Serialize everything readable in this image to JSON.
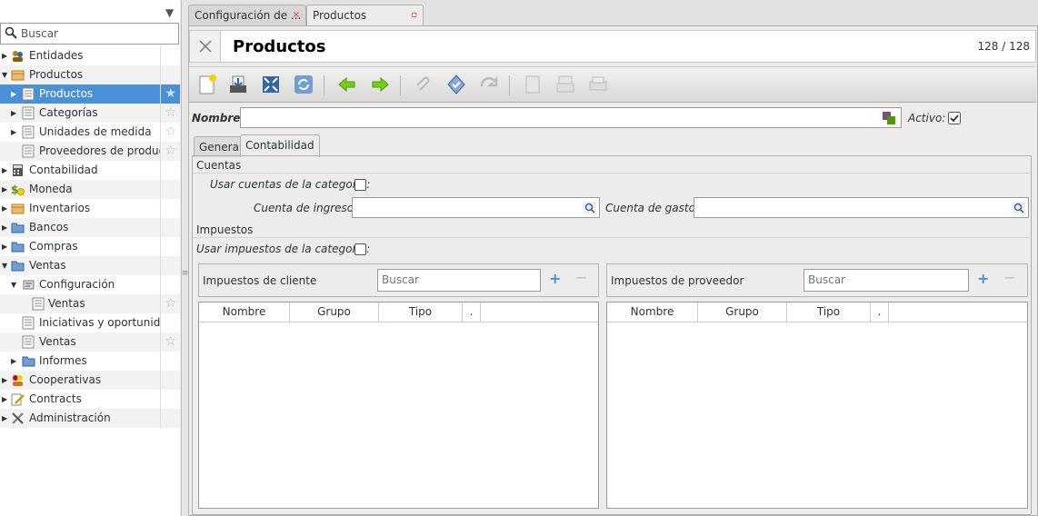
{
  "sidebar": {
    "search_placeholder": "Buscar",
    "items": [
      {
        "label": "Entidades",
        "icon": "people-icon"
      },
      {
        "label": "Productos",
        "icon": "box-icon"
      },
      {
        "label": "Productos",
        "icon": "list-icon"
      },
      {
        "label": "Categorías",
        "icon": "list-icon"
      },
      {
        "label": "Unidades de medida",
        "icon": "list-icon"
      },
      {
        "label": "Proveedores de producto",
        "icon": "list-icon"
      },
      {
        "label": "Contabilidad",
        "icon": "calculator-icon"
      },
      {
        "label": "Moneda",
        "icon": "money-icon"
      },
      {
        "label": "Inventarios",
        "icon": "box-icon"
      },
      {
        "label": "Bancos",
        "icon": "folder-icon"
      },
      {
        "label": "Compras",
        "icon": "folder-icon"
      },
      {
        "label": "Ventas",
        "icon": "folder-icon"
      },
      {
        "label": "Configuración",
        "icon": "settings-icon"
      },
      {
        "label": "Ventas",
        "icon": "list-icon"
      },
      {
        "label": "Iniciativas y oportunidad",
        "icon": "list-icon"
      },
      {
        "label": "Ventas",
        "icon": "list-icon"
      },
      {
        "label": "Informes",
        "icon": "folder-icon"
      },
      {
        "label": "Cooperativas",
        "icon": "people-icon"
      },
      {
        "label": "Contracts",
        "icon": "edit-icon"
      },
      {
        "label": "Administración",
        "icon": "tools-icon"
      }
    ]
  },
  "tabs": [
    {
      "label": "Configuración de ..."
    },
    {
      "label": "Productos"
    }
  ],
  "header": {
    "title": "Productos",
    "record_counter": "128 / 128"
  },
  "form": {
    "name_label": "Nombre:",
    "active_label": "Activo:",
    "active_checked": true,
    "subtabs": [
      {
        "label": "General"
      },
      {
        "label": "Contabilidad"
      }
    ],
    "cuentas_heading": "Cuentas",
    "use_category_accounts_label": "Usar cuentas de la categoría:",
    "income_account_label": "Cuenta de ingresos:",
    "expense_account_label": "Cuenta de gastos:",
    "impuestos_heading": "Impuestos",
    "use_category_taxes_label": "Usar impuestos de la categoría:",
    "customer_taxes": {
      "title": "Impuestos de cliente",
      "search_placeholder": "Buscar",
      "columns": [
        "Nombre",
        "Grupo",
        "Tipo",
        "."
      ]
    },
    "supplier_taxes": {
      "title": "Impuestos de proveedor",
      "search_placeholder": "Buscar",
      "columns": [
        "Nombre",
        "Grupo",
        "Tipo",
        "."
      ]
    }
  },
  "colors": {
    "selection": "#4a90d9",
    "accent_green": "#4e9a06"
  }
}
